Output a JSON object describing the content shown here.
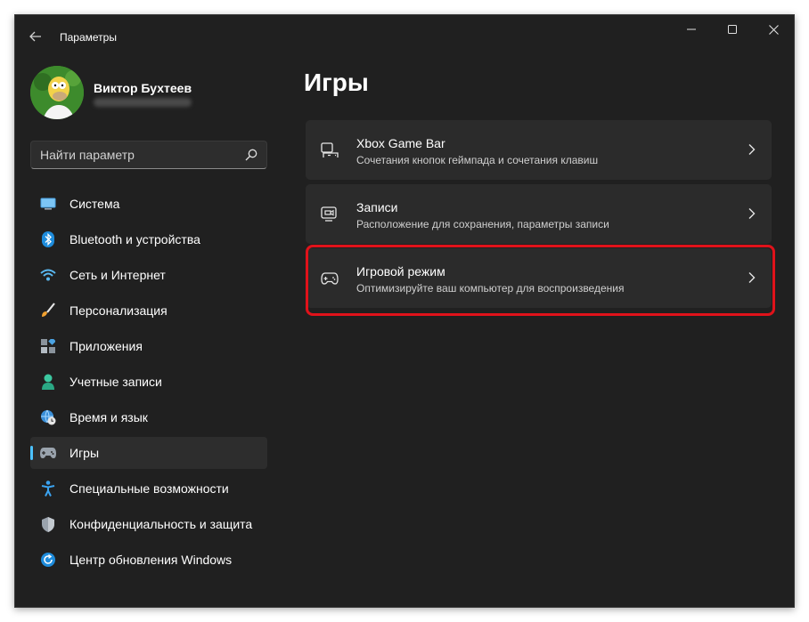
{
  "window": {
    "title": "Параметры"
  },
  "profile": {
    "name": "Виктор Бухтеев"
  },
  "search": {
    "placeholder": "Найти параметр"
  },
  "sidebar": {
    "items": [
      {
        "label": "Система",
        "icon": "display-icon"
      },
      {
        "label": "Bluetooth и устройства",
        "icon": "bluetooth-icon"
      },
      {
        "label": "Сеть и Интернет",
        "icon": "wifi-icon"
      },
      {
        "label": "Персонализация",
        "icon": "brush-icon"
      },
      {
        "label": "Приложения",
        "icon": "apps-icon"
      },
      {
        "label": "Учетные записи",
        "icon": "person-icon"
      },
      {
        "label": "Время и язык",
        "icon": "globe-clock-icon"
      },
      {
        "label": "Игры",
        "icon": "gamepad-icon",
        "active": true
      },
      {
        "label": "Специальные возможности",
        "icon": "accessibility-icon"
      },
      {
        "label": "Конфиденциальность и защита",
        "icon": "shield-icon"
      },
      {
        "label": "Центр обновления Windows",
        "icon": "update-icon"
      }
    ]
  },
  "main": {
    "title": "Игры",
    "cards": [
      {
        "title": "Xbox Game Bar",
        "subtitle": "Сочетания кнопок геймпада и сочетания клавиш",
        "icon": "game-bar-icon"
      },
      {
        "title": "Записи",
        "subtitle": "Расположение для сохранения, параметры записи",
        "icon": "capture-icon"
      },
      {
        "title": "Игровой режим",
        "subtitle": "Оптимизируйте ваш компьютер для воспроизведения",
        "icon": "game-mode-icon",
        "highlighted": true
      }
    ]
  },
  "colors": {
    "accent": "#4cc2ff",
    "highlight": "#e0121a",
    "background": "#202020",
    "card": "#2b2b2b"
  }
}
